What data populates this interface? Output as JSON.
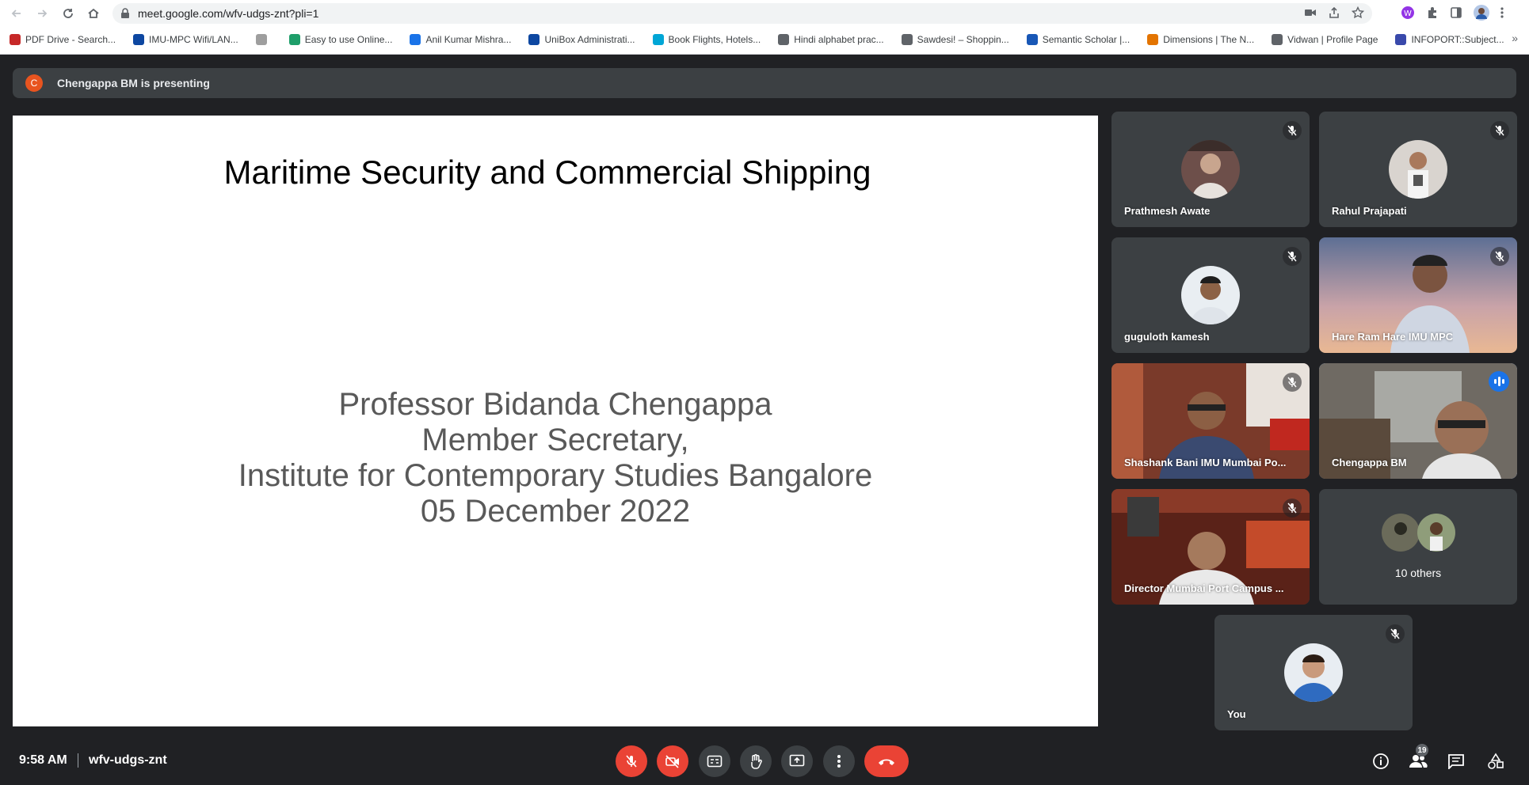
{
  "browser": {
    "url": "meet.google.com/wfv-udgs-znt?pli=1",
    "bookmarks": [
      {
        "label": "PDF Drive - Search...",
        "color": "#c62828"
      },
      {
        "label": "IMU-MPC Wifi/LAN...",
        "color": "#0d47a1"
      },
      {
        "label": "",
        "color": "#9e9e9e"
      },
      {
        "label": "Easy to use Online...",
        "color": "#1e9e6a"
      },
      {
        "label": "Anil Kumar Mishra...",
        "color": "#1a73e8"
      },
      {
        "label": "UniBox Administrati...",
        "color": "#0d47a1"
      },
      {
        "label": "Book Flights, Hotels...",
        "color": "#00a6d6"
      },
      {
        "label": "Hindi alphabet prac...",
        "color": "#5f6368"
      },
      {
        "label": "Sawdesi! – Shoppin...",
        "color": "#5f6368"
      },
      {
        "label": "Semantic Scholar |...",
        "color": "#1857b6"
      },
      {
        "label": "Dimensions | The N...",
        "color": "#e37400"
      },
      {
        "label": "Vidwan | Profile Page",
        "color": "#5f6368"
      },
      {
        "label": "INFOPORT::Subject...",
        "color": "#3949ab"
      }
    ]
  },
  "presenting": {
    "avatar_letter": "C",
    "text": "Chengappa BM is presenting"
  },
  "slide": {
    "title": "Maritime Security and Commercial Shipping",
    "lines": [
      "Professor Bidanda Chengappa",
      "Member Secretary,",
      "Institute for Contemporary Studies Bangalore",
      "05 December 2022"
    ]
  },
  "participants": [
    {
      "name": "Prathmesh Awate"
    },
    {
      "name": "Rahul Prajapati"
    },
    {
      "name": "guguloth kamesh"
    },
    {
      "name": "Hare Ram Hare IMU MPC"
    },
    {
      "name": "Shashank Bani IMU Mumbai Po..."
    },
    {
      "name": "Chengappa BM"
    },
    {
      "name": "Director Mumbai Port Campus ..."
    },
    {
      "name": "10 others"
    },
    {
      "name": "You"
    }
  ],
  "bottom": {
    "time": "9:58 AM",
    "meeting_code": "wfv-udgs-znt",
    "participant_count": "19"
  },
  "colors": {
    "background": "#202124",
    "tile": "#3c4043",
    "hangup": "#ea4335",
    "active_speaker": "#8ab4f8"
  }
}
